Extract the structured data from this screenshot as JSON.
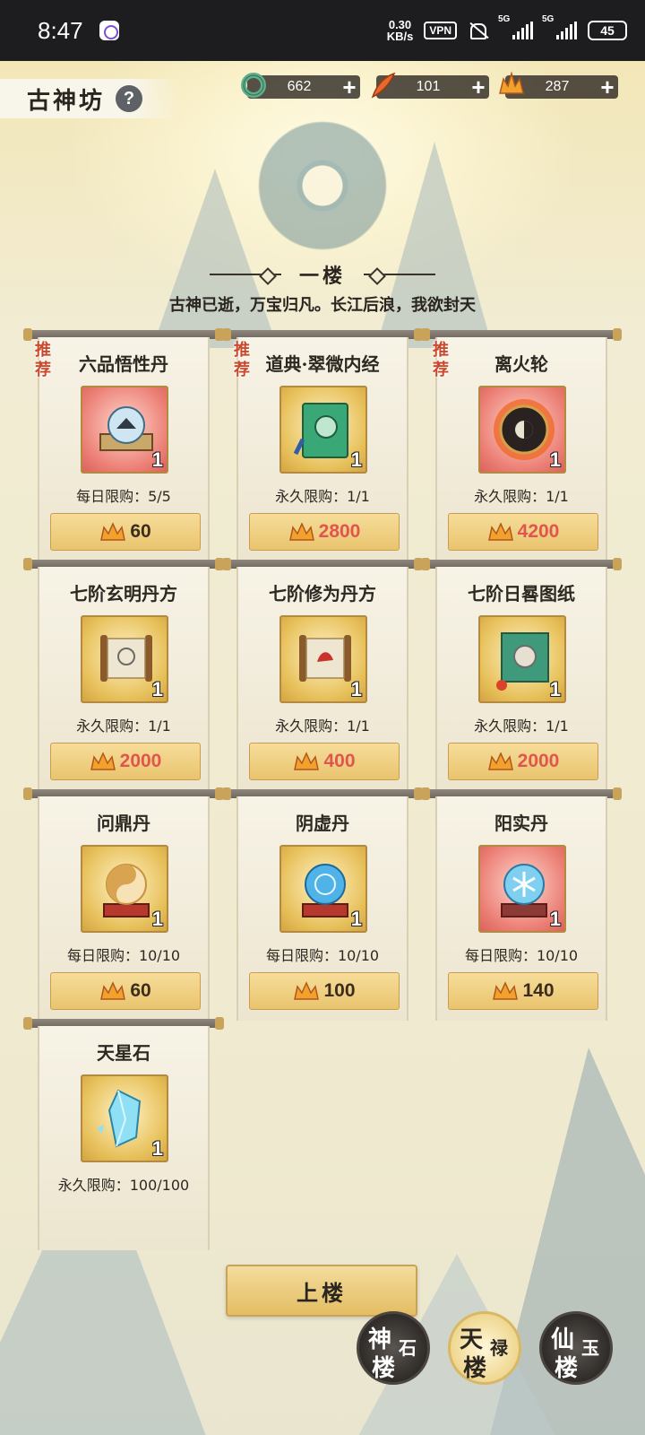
{
  "status_bar": {
    "time": "8:47",
    "speed_value": "0.30",
    "speed_unit": "KB/s",
    "vpn": "VPN",
    "sig1": "5G",
    "sig2": "5G",
    "battery": "45"
  },
  "header": {
    "title": "古神坊",
    "help": "?",
    "currencies": [
      {
        "icon": "jade-ring-icon",
        "value": "662",
        "plus": "+"
      },
      {
        "icon": "feather-icon",
        "value": "101",
        "plus": "+"
      },
      {
        "icon": "flame-crown-icon",
        "value": "287",
        "plus": "+"
      }
    ]
  },
  "floor": {
    "title": "一楼",
    "slogan": "古神已逝，万宝归凡。长江后浪，我欲封天"
  },
  "items": [
    {
      "name": "六品悟性丹",
      "recommended": "推荐",
      "rec_a": "推",
      "rec_b": "荐",
      "frame": "red",
      "icon": "cultivation-pill-scroll-icon",
      "qty": "1",
      "limit": "每日限购：5/5",
      "price": "60",
      "affordable": true
    },
    {
      "name": "道典·翠微内经",
      "recommended": "推荐",
      "rec_a": "推",
      "rec_b": "荐",
      "frame": "gold",
      "icon": "green-book-icon",
      "qty": "1",
      "limit": "永久限购：1/1",
      "price": "2800",
      "affordable": false
    },
    {
      "name": "离火轮",
      "recommended": "推荐",
      "rec_a": "推",
      "rec_b": "荐",
      "frame": "red",
      "icon": "fire-wheel-icon",
      "qty": "1",
      "limit": "永久限购：1/1",
      "price": "4200",
      "affordable": false
    },
    {
      "name": "七阶玄明丹方",
      "frame": "gold",
      "icon": "recipe-scroll-icon",
      "qty": "1",
      "limit": "永久限购：1/1",
      "price": "2000",
      "affordable": false
    },
    {
      "name": "七阶修为丹方",
      "frame": "gold",
      "icon": "recipe-scroll-red-icon",
      "qty": "1",
      "limit": "永久限购：1/1",
      "price": "400",
      "affordable": false
    },
    {
      "name": "七阶日晷图纸",
      "frame": "gold",
      "icon": "sundial-scroll-icon",
      "qty": "1",
      "limit": "永久限购：1/1",
      "price": "2000",
      "affordable": false
    },
    {
      "name": "问鼎丹",
      "frame": "gold",
      "icon": "yin-yang-orb-icon",
      "qty": "1",
      "limit": "每日限购：10/10",
      "price": "60",
      "affordable": true
    },
    {
      "name": "阴虚丹",
      "frame": "gold",
      "icon": "blue-orb-icon",
      "qty": "1",
      "limit": "每日限购：10/10",
      "price": "100",
      "affordable": true
    },
    {
      "name": "阳实丹",
      "frame": "red",
      "icon": "snowflake-orb-icon",
      "qty": "1",
      "limit": "每日限购：10/10",
      "price": "140",
      "affordable": true
    },
    {
      "name": "天星石",
      "frame": "gold",
      "icon": "crystal-icon",
      "qty": "1",
      "limit": "永久限购：100/100",
      "price": "",
      "affordable": true
    }
  ],
  "footer": {
    "upstairs": "上楼",
    "towers": [
      {
        "a": "神",
        "b": "石",
        "c": "楼",
        "active": false
      },
      {
        "a": "天",
        "b": "禄",
        "c": "楼",
        "active": true
      },
      {
        "a": "仙",
        "b": "玉",
        "c": "楼",
        "active": false
      }
    ]
  },
  "colors": {
    "price_unaffordable": "#e0564e",
    "price_ok": "#3b2c1c",
    "button_gold": "#e9c46e",
    "recommend_red": "#c9492c"
  }
}
